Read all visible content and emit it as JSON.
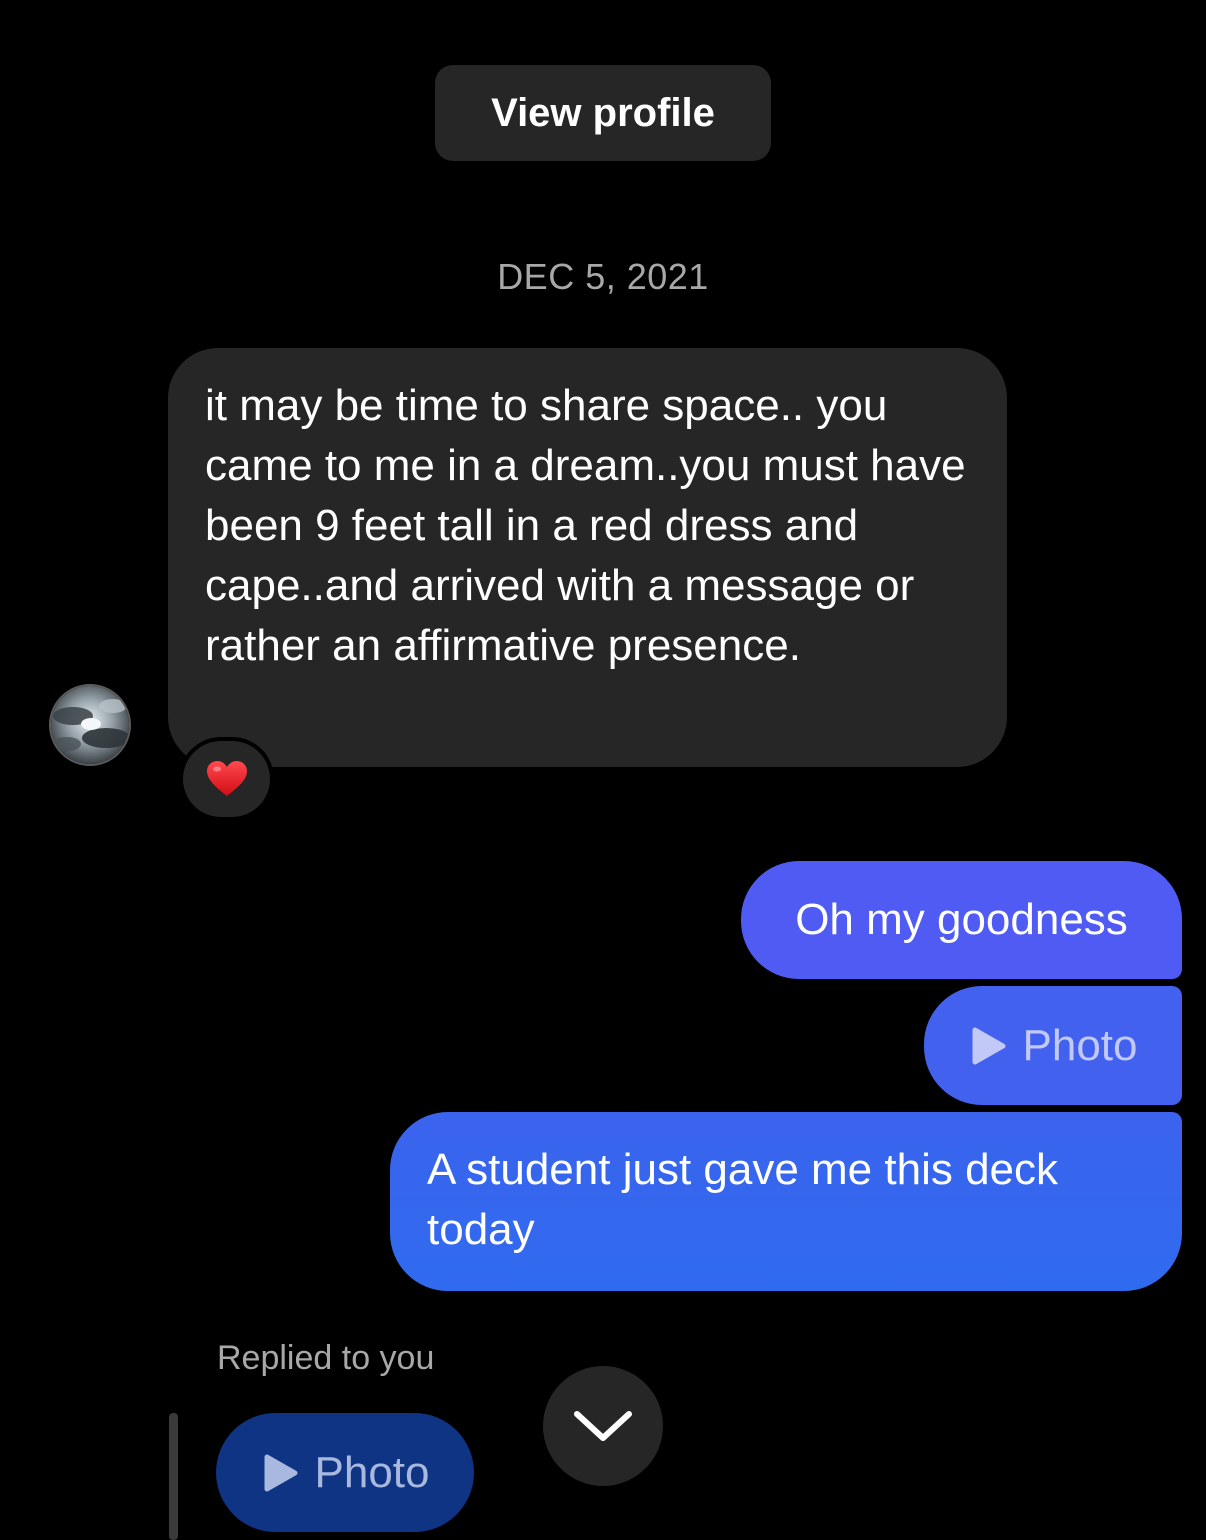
{
  "header": {
    "view_profile_label": "View profile"
  },
  "conversation": {
    "date_separator": "DEC 5, 2021",
    "incoming_message": {
      "text": "it may be time to share space.. you came to me in a dream..you must have been 9 feet tall in a red dress and cape..and arrived with a message or rather an affirmative presence.",
      "reaction": "heart-emoji"
    },
    "outgoing_messages": [
      {
        "type": "text",
        "text": "Oh my goodness"
      },
      {
        "type": "photo",
        "label": "Photo",
        "icon": "play-icon"
      },
      {
        "type": "text",
        "text": "A student just gave me this deck today"
      }
    ],
    "reply": {
      "label": "Replied to you",
      "quoted_label": "Photo",
      "icon": "play-icon"
    }
  },
  "colors": {
    "background": "#000000",
    "incoming_bubble": "#262626",
    "outgoing_bubble_top": "#4f5bf2",
    "outgoing_bubble_bottom": "#2f6bef",
    "quoted_reply_bubble": "#0f3484",
    "secondary_text": "#a8a8a8",
    "heart": "#e0131a"
  },
  "controls": {
    "scroll_down_icon": "chevron-down-icon"
  }
}
